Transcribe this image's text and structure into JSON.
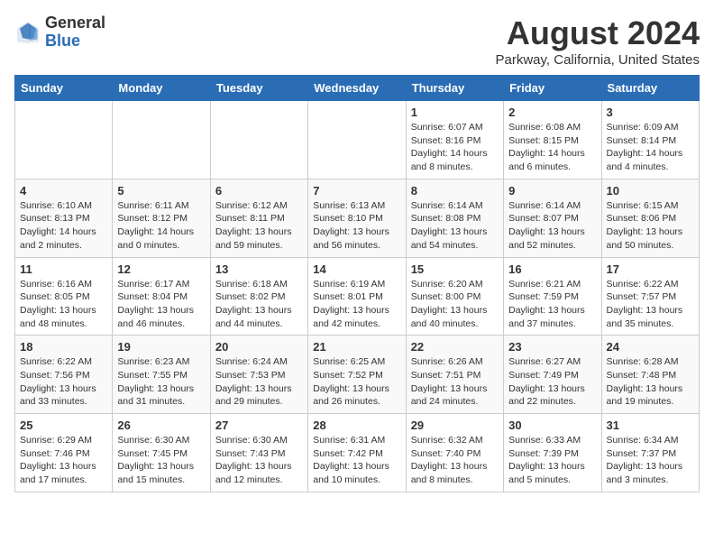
{
  "header": {
    "logo_general": "General",
    "logo_blue": "Blue",
    "month_year": "August 2024",
    "location": "Parkway, California, United States"
  },
  "days_of_week": [
    "Sunday",
    "Monday",
    "Tuesday",
    "Wednesday",
    "Thursday",
    "Friday",
    "Saturday"
  ],
  "weeks": [
    [
      {
        "day": "",
        "info": ""
      },
      {
        "day": "",
        "info": ""
      },
      {
        "day": "",
        "info": ""
      },
      {
        "day": "",
        "info": ""
      },
      {
        "day": "1",
        "info": "Sunrise: 6:07 AM\nSunset: 8:16 PM\nDaylight: 14 hours\nand 8 minutes."
      },
      {
        "day": "2",
        "info": "Sunrise: 6:08 AM\nSunset: 8:15 PM\nDaylight: 14 hours\nand 6 minutes."
      },
      {
        "day": "3",
        "info": "Sunrise: 6:09 AM\nSunset: 8:14 PM\nDaylight: 14 hours\nand 4 minutes."
      }
    ],
    [
      {
        "day": "4",
        "info": "Sunrise: 6:10 AM\nSunset: 8:13 PM\nDaylight: 14 hours\nand 2 minutes."
      },
      {
        "day": "5",
        "info": "Sunrise: 6:11 AM\nSunset: 8:12 PM\nDaylight: 14 hours\nand 0 minutes."
      },
      {
        "day": "6",
        "info": "Sunrise: 6:12 AM\nSunset: 8:11 PM\nDaylight: 13 hours\nand 59 minutes."
      },
      {
        "day": "7",
        "info": "Sunrise: 6:13 AM\nSunset: 8:10 PM\nDaylight: 13 hours\nand 56 minutes."
      },
      {
        "day": "8",
        "info": "Sunrise: 6:14 AM\nSunset: 8:08 PM\nDaylight: 13 hours\nand 54 minutes."
      },
      {
        "day": "9",
        "info": "Sunrise: 6:14 AM\nSunset: 8:07 PM\nDaylight: 13 hours\nand 52 minutes."
      },
      {
        "day": "10",
        "info": "Sunrise: 6:15 AM\nSunset: 8:06 PM\nDaylight: 13 hours\nand 50 minutes."
      }
    ],
    [
      {
        "day": "11",
        "info": "Sunrise: 6:16 AM\nSunset: 8:05 PM\nDaylight: 13 hours\nand 48 minutes."
      },
      {
        "day": "12",
        "info": "Sunrise: 6:17 AM\nSunset: 8:04 PM\nDaylight: 13 hours\nand 46 minutes."
      },
      {
        "day": "13",
        "info": "Sunrise: 6:18 AM\nSunset: 8:02 PM\nDaylight: 13 hours\nand 44 minutes."
      },
      {
        "day": "14",
        "info": "Sunrise: 6:19 AM\nSunset: 8:01 PM\nDaylight: 13 hours\nand 42 minutes."
      },
      {
        "day": "15",
        "info": "Sunrise: 6:20 AM\nSunset: 8:00 PM\nDaylight: 13 hours\nand 40 minutes."
      },
      {
        "day": "16",
        "info": "Sunrise: 6:21 AM\nSunset: 7:59 PM\nDaylight: 13 hours\nand 37 minutes."
      },
      {
        "day": "17",
        "info": "Sunrise: 6:22 AM\nSunset: 7:57 PM\nDaylight: 13 hours\nand 35 minutes."
      }
    ],
    [
      {
        "day": "18",
        "info": "Sunrise: 6:22 AM\nSunset: 7:56 PM\nDaylight: 13 hours\nand 33 minutes."
      },
      {
        "day": "19",
        "info": "Sunrise: 6:23 AM\nSunset: 7:55 PM\nDaylight: 13 hours\nand 31 minutes."
      },
      {
        "day": "20",
        "info": "Sunrise: 6:24 AM\nSunset: 7:53 PM\nDaylight: 13 hours\nand 29 minutes."
      },
      {
        "day": "21",
        "info": "Sunrise: 6:25 AM\nSunset: 7:52 PM\nDaylight: 13 hours\nand 26 minutes."
      },
      {
        "day": "22",
        "info": "Sunrise: 6:26 AM\nSunset: 7:51 PM\nDaylight: 13 hours\nand 24 minutes."
      },
      {
        "day": "23",
        "info": "Sunrise: 6:27 AM\nSunset: 7:49 PM\nDaylight: 13 hours\nand 22 minutes."
      },
      {
        "day": "24",
        "info": "Sunrise: 6:28 AM\nSunset: 7:48 PM\nDaylight: 13 hours\nand 19 minutes."
      }
    ],
    [
      {
        "day": "25",
        "info": "Sunrise: 6:29 AM\nSunset: 7:46 PM\nDaylight: 13 hours\nand 17 minutes."
      },
      {
        "day": "26",
        "info": "Sunrise: 6:30 AM\nSunset: 7:45 PM\nDaylight: 13 hours\nand 15 minutes."
      },
      {
        "day": "27",
        "info": "Sunrise: 6:30 AM\nSunset: 7:43 PM\nDaylight: 13 hours\nand 12 minutes."
      },
      {
        "day": "28",
        "info": "Sunrise: 6:31 AM\nSunset: 7:42 PM\nDaylight: 13 hours\nand 10 minutes."
      },
      {
        "day": "29",
        "info": "Sunrise: 6:32 AM\nSunset: 7:40 PM\nDaylight: 13 hours\nand 8 minutes."
      },
      {
        "day": "30",
        "info": "Sunrise: 6:33 AM\nSunset: 7:39 PM\nDaylight: 13 hours\nand 5 minutes."
      },
      {
        "day": "31",
        "info": "Sunrise: 6:34 AM\nSunset: 7:37 PM\nDaylight: 13 hours\nand 3 minutes."
      }
    ]
  ]
}
